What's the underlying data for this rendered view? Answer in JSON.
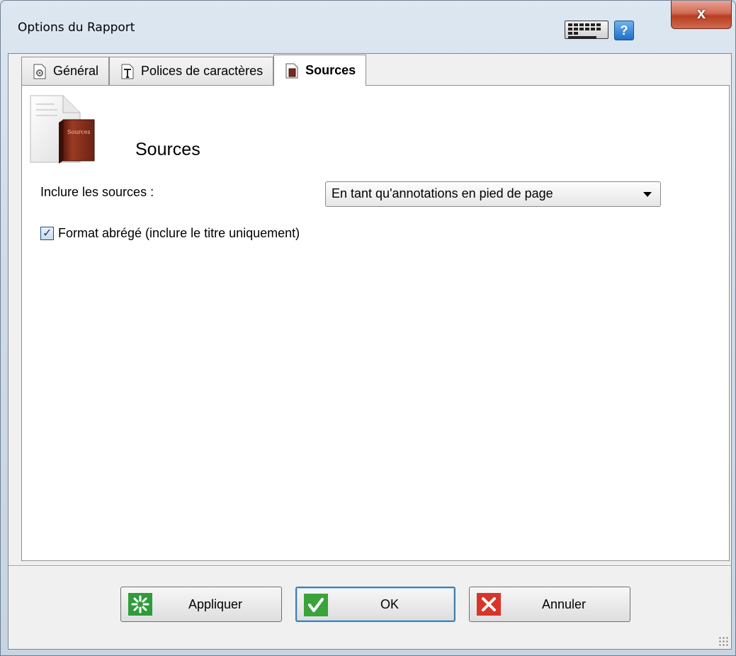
{
  "window": {
    "title": "Options du Rapport",
    "close_label": "x",
    "help_label": "?"
  },
  "tabs": [
    {
      "label": "Général",
      "icon": "gear-page-icon",
      "active": false
    },
    {
      "label": "Polices de caractères",
      "icon": "font-page-icon",
      "active": false
    },
    {
      "label": "Sources",
      "icon": "book-page-icon",
      "active": true
    }
  ],
  "panel": {
    "title": "Sources",
    "icon": "sources-book-icon",
    "book_text": "Sources",
    "include_label": "Inclure les sources :",
    "include_value": "En tant qu'annotations en pied de page",
    "abbrev_label": "Format abrégé (inclure le titre uniquement)",
    "abbrev_checked": true
  },
  "buttons": {
    "apply": "Appliquer",
    "ok": "OK",
    "cancel": "Annuler"
  },
  "colors": {
    "apply_icon": "#2e9c3a",
    "ok_icon": "#3aa33a",
    "cancel_icon": "#d8352a",
    "close_button": "#c9513a"
  }
}
